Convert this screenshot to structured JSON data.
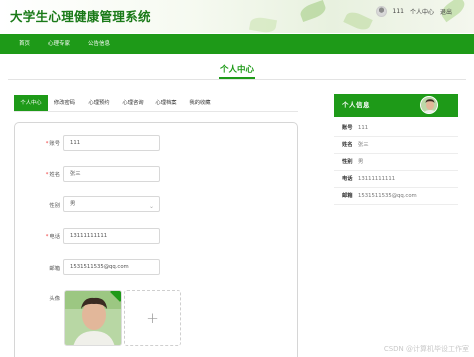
{
  "header": {
    "site_title": "大学生心理健康管理系统",
    "username": "111",
    "user_center": "个人中心",
    "logout": "退出"
  },
  "nav": [
    "首页",
    "心理专家",
    "公告信息"
  ],
  "page_title": "个人中心",
  "tabs": [
    "个人中心",
    "修改密码",
    "心理预约",
    "心理咨询",
    "心理档案",
    "我的收藏"
  ],
  "form": {
    "account_label": "账号",
    "account_value": "111",
    "name_label": "姓名",
    "name_value": "张三",
    "gender_label": "性别",
    "gender_value": "男",
    "phone_label": "电话",
    "phone_value": "13111111111",
    "email_label": "邮箱",
    "email_value": "1531511535@qq.com",
    "avatar_label": "头像",
    "required_mark": "*",
    "add_symbol": "+"
  },
  "profile_card": {
    "title": "个人信息",
    "rows": [
      {
        "key": "账号",
        "value": "111"
      },
      {
        "key": "姓名",
        "value": "张三"
      },
      {
        "key": "性别",
        "value": "男"
      },
      {
        "key": "电话",
        "value": "13111111111"
      },
      {
        "key": "邮箱",
        "value": "1531511535@qq.com"
      }
    ]
  },
  "watermark": "CSDN @计算机毕设工作室",
  "colors": {
    "primary": "#1e9a18",
    "title_green": "#1a7a18"
  },
  "icons": [
    "avatar-icon",
    "chevron-down-icon",
    "plus-icon",
    "check-icon"
  ]
}
